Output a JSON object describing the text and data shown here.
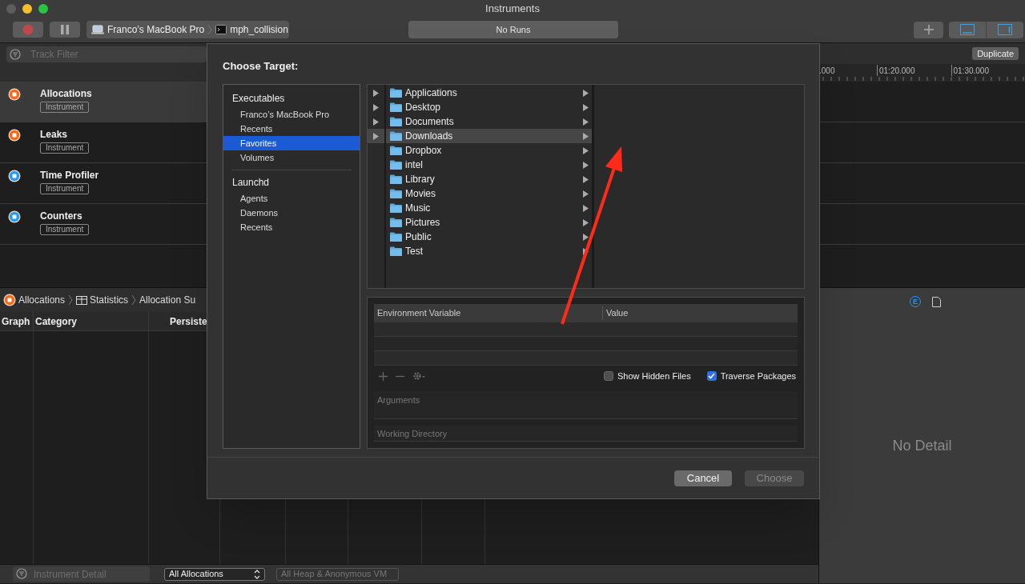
{
  "window": {
    "title": "Instruments"
  },
  "toolbar": {
    "target_device": "Franco’s MacBook Pro",
    "target_process": "mph_collision",
    "status": "No Runs",
    "panel_toggles": [
      {
        "kind": "bottom",
        "on": true
      },
      {
        "kind": "right",
        "on": true
      }
    ]
  },
  "track_filter": {
    "placeholder": "Track Filter"
  },
  "duplicate_button": "Duplicate",
  "timeline_ticks": [
    ".000",
    "01:20.000",
    "01:30.000"
  ],
  "instruments": [
    {
      "name": "Allocations",
      "badge": "Instrument",
      "color": "#f26b1d",
      "selected": true
    },
    {
      "name": "Leaks",
      "badge": "Instrument",
      "color": "#f26b1d",
      "selected": false
    },
    {
      "name": "Time Profiler",
      "badge": "Instrument",
      "color": "#1e9df1",
      "selected": false
    },
    {
      "name": "Counters",
      "badge": "Instrument",
      "color": "#1e9df1",
      "selected": false
    }
  ],
  "breadcrumb": [
    {
      "kind": "instrument",
      "label": "Allocations"
    },
    {
      "kind": "table",
      "label": "Statistics"
    },
    {
      "kind": "plain",
      "label": "Allocation Su"
    }
  ],
  "table": {
    "columns": [
      "Graph",
      "Category",
      "Persiste"
    ]
  },
  "bottom_bar": {
    "filter_placeholder": "Instrument Detail",
    "popups": [
      {
        "value": "All Allocations",
        "disabled": false
      },
      {
        "value": "All Heap & Anonymous VM",
        "disabled": true
      }
    ]
  },
  "inspector": {
    "tabs": [
      {
        "kind": "letter",
        "glyph": "E",
        "selected": true
      },
      {
        "kind": "document",
        "selected": false
      }
    ],
    "empty_text": "No Detail"
  },
  "dialog": {
    "title": "Choose Target:",
    "sources": [
      {
        "label": "Executables",
        "children": [
          {
            "label": "Franco’s MacBook Pro",
            "selected": false
          },
          {
            "label": "Recents",
            "selected": false
          },
          {
            "label": "Favorites",
            "selected": true
          },
          {
            "label": "Volumes",
            "selected": false
          }
        ]
      },
      {
        "label": "Launchd",
        "children": [
          {
            "label": "Agents",
            "selected": false
          },
          {
            "label": "Daemons",
            "selected": false
          },
          {
            "label": "Recents",
            "selected": false
          }
        ]
      }
    ],
    "previous_column": [
      {
        "selected": false
      },
      {
        "selected": false
      },
      {
        "selected": false
      },
      {
        "selected": true
      }
    ],
    "folders": [
      {
        "name": "Applications",
        "selected": false
      },
      {
        "name": "Desktop",
        "selected": false
      },
      {
        "name": "Documents",
        "selected": false
      },
      {
        "name": "Downloads",
        "selected": true
      },
      {
        "name": "Dropbox",
        "selected": false
      },
      {
        "name": "intel",
        "selected": false
      },
      {
        "name": "Library",
        "selected": false
      },
      {
        "name": "Movies",
        "selected": false
      },
      {
        "name": "Music",
        "selected": false
      },
      {
        "name": "Pictures",
        "selected": false
      },
      {
        "name": "Public",
        "selected": false
      },
      {
        "name": "Test",
        "selected": false
      }
    ],
    "env_table": {
      "columns": [
        "Environment Variable",
        "Value"
      ]
    },
    "options": [
      {
        "label": "Show Hidden Files",
        "checked": false
      },
      {
        "label": "Traverse Packages",
        "checked": true
      }
    ],
    "arguments_placeholder": "Arguments",
    "working_directory_placeholder": "Working Directory",
    "buttons": [
      {
        "label": "Cancel",
        "disabled": false
      },
      {
        "label": "Choose",
        "disabled": true
      }
    ]
  }
}
